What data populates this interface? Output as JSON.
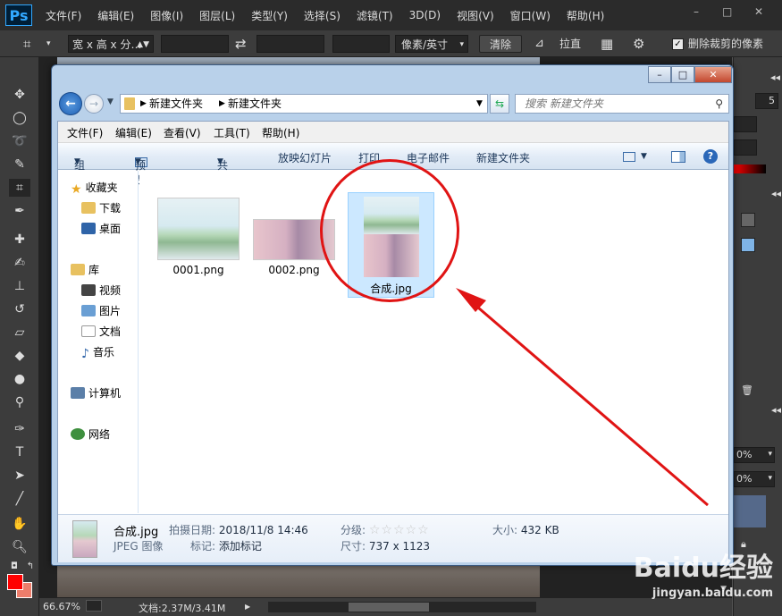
{
  "ps": {
    "logo": "Ps",
    "menu": [
      "文件(F)",
      "编辑(E)",
      "图像(I)",
      "图层(L)",
      "类型(Y)",
      "选择(S)",
      "滤镜(T)",
      "3D(D)",
      "视图(V)",
      "窗口(W)",
      "帮助(H)"
    ],
    "window_controls": {
      "min": "–",
      "max": "□",
      "close": "✕"
    },
    "options": {
      "ratio_label": "宽 x 高 x 分…",
      "unit_label": "像素/英寸",
      "clear_label": "清除",
      "straighten_label": "拉直",
      "delete_cropped_label": "删除裁剪的像素",
      "delete_cropped_checked": true
    },
    "status": {
      "zoom": "66.67%",
      "doc": "文档:2.37M/3.41M"
    },
    "panels": {
      "value1": "5",
      "opacity1": "0%",
      "opacity2": "0%"
    },
    "colors": {
      "foreground": "#ff0000",
      "background": "#ed7d6b"
    }
  },
  "explorer": {
    "window_controls": {
      "min": "–",
      "max": "□",
      "close": "✕"
    },
    "breadcrumb": [
      "新建文件夹",
      "新建文件夹"
    ],
    "search_placeholder": "搜索 新建文件夹",
    "menu": [
      "文件(F)",
      "编辑(E)",
      "查看(V)",
      "工具(T)",
      "帮助(H)"
    ],
    "commands": {
      "organize": "组织",
      "preview": "预览",
      "share": "共享",
      "slideshow": "放映幻灯片",
      "print": "打印",
      "email": "电子邮件",
      "new_folder": "新建文件夹"
    },
    "nav": {
      "favorites": "收藏夹",
      "downloads": "下载",
      "desktop": "桌面",
      "libraries": "库",
      "videos": "视频",
      "pictures": "图片",
      "documents": "文档",
      "music": "音乐",
      "computer": "计算机",
      "network": "网络"
    },
    "files": [
      {
        "name": "0001.png"
      },
      {
        "name": "0002.png"
      },
      {
        "name": "合成.jpg",
        "selected": true
      }
    ],
    "details": {
      "filename": "合成.jpg",
      "filetype": "JPEG 图像",
      "date_key": "拍摄日期:",
      "date_val": "2018/11/8 14:46",
      "tags_key": "标记:",
      "tags_val": "添加标记",
      "rating_key": "分级:",
      "dims_key": "尺寸:",
      "dims_val": "737 x 1123",
      "size_key": "大小:",
      "size_val": "432 KB"
    }
  },
  "watermark": {
    "logo": "Baidu经验",
    "url": "jingyan.baidu.com"
  }
}
